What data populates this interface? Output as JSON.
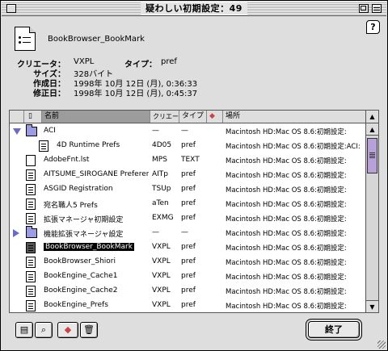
{
  "window": {
    "title": "疑わしい初期設定：49"
  },
  "file": {
    "name": "BookBrowser_BookMark",
    "info": [
      {
        "label": "クリエータ：",
        "value": "VXPL"
      },
      {
        "label": "サイズ：",
        "value": "328バイト"
      },
      {
        "label": "作成日：",
        "value": "1998年 10月 12日 (月), 0:36:33"
      },
      {
        "label": "修正日：",
        "value": "1998年 10月 12日 (月), 0:45:37"
      }
    ],
    "type_label": "タイプ：",
    "type_value": "pref"
  },
  "list": {
    "headers": {
      "name": "名前",
      "creator": "クリエータ",
      "type": "タイプ",
      "place": "場所"
    },
    "rows": [
      {
        "name": "ACI",
        "creator": "—",
        "type": "—",
        "place": "Macintosh HD:Mac OS 8.6:初期設定:",
        "kind": "folder-open"
      },
      {
        "name": "4D Runtime Prefs",
        "creator": "4D05",
        "type": "pref",
        "place": "Macintosh HD:Mac OS 8.6:初期設定:ACI:",
        "kind": "doc-indent"
      },
      {
        "name": "AdobeFnt.lst",
        "creator": "MPS",
        "type": "TEXT",
        "place": "Macintosh HD:Mac OS 8.6:初期設定:",
        "kind": "doc-plain"
      },
      {
        "name": "AITSUME_SIROGANE Preferences",
        "creator": "AITp",
        "type": "pref",
        "place": "Macintosh HD:Mac OS 8.6:初期設定:",
        "kind": "doc"
      },
      {
        "name": "ASGID Registration",
        "creator": "TSUp",
        "type": "pref",
        "place": "Macintosh HD:Mac OS 8.6:初期設定:",
        "kind": "doc"
      },
      {
        "name": "宛名職人5 Prefs",
        "creator": "aTen",
        "type": "pref",
        "place": "Macintosh HD:Mac OS 8.6:初期設定:",
        "kind": "doc"
      },
      {
        "name": "拡張マネージャ初期設定",
        "creator": "EXMG",
        "type": "pref",
        "place": "Macintosh HD:Mac OS 8.6:初期設定:",
        "kind": "doc"
      },
      {
        "name": "機能拡張マネージャ設定",
        "creator": "—",
        "type": "—",
        "place": "Macintosh HD:Mac OS 8.6:初期設定:",
        "kind": "folder-closed"
      },
      {
        "name": "BookBrowser_BookMark",
        "creator": "VXPL",
        "type": "pref",
        "place": "Macintosh HD:Mac OS 8.6:初期設定:",
        "kind": "doc-dark",
        "selected": true
      },
      {
        "name": "BookBrowser_Shiori",
        "creator": "VXPL",
        "type": "pref",
        "place": "Macintosh HD:Mac OS 8.6:初期設定:",
        "kind": "doc"
      },
      {
        "name": "BookEngine_Cache1",
        "creator": "VXPL",
        "type": "pref",
        "place": "Macintosh HD:Mac OS 8.6:初期設定:",
        "kind": "doc"
      },
      {
        "name": "BookEngine_Cache2",
        "creator": "VXPL",
        "type": "pref",
        "place": "Macintosh HD:Mac OS 8.6:初期設定:",
        "kind": "doc"
      },
      {
        "name": "BookEngine_Prefs",
        "creator": "VXPL",
        "type": "pref",
        "place": "Macintosh HD:Mac OS 8.6:初期設定:",
        "kind": "doc"
      }
    ]
  },
  "buttons": {
    "done": "終了",
    "help": "?"
  }
}
